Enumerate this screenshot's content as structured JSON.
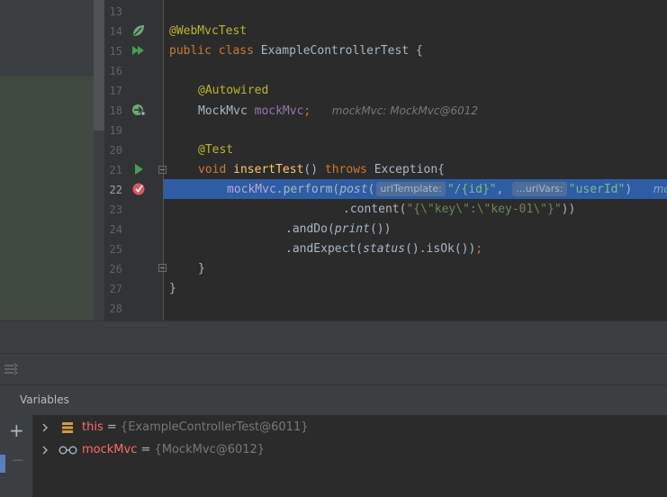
{
  "editor": {
    "lines": [
      {
        "num": "13"
      },
      {
        "num": "14",
        "ann": "@WebMvcTest"
      },
      {
        "num": "15",
        "kw1": "public",
        "kw2": "class",
        "cls": "ExampleControllerTest",
        "brace": "{"
      },
      {
        "num": "16"
      },
      {
        "num": "17",
        "ann": "@Autowired"
      },
      {
        "num": "18",
        "type": "MockMvc",
        "field": "mockMvc",
        "semi": ";",
        "hint": "mockMvc: MockMvc@6012"
      },
      {
        "num": "19"
      },
      {
        "num": "20",
        "ann": "@Test"
      },
      {
        "num": "21",
        "kw": "void",
        "method": "insertTest",
        "params": "()",
        "throws": "throws",
        "exc": "Exception{"
      },
      {
        "num": "22",
        "field": "mockMvc",
        "dot_perform": ".perform(",
        "post": "post",
        "paren": "(",
        "ph1": "urlTemplate:",
        "str1": "\"/{id}\"",
        "comma": ",",
        "ph2": "...uriVars:",
        "str2": "\"userId\"",
        "close": ")",
        "trail": "mc"
      },
      {
        "num": "23",
        "content": ".content(",
        "str": "\"{\\\"key\\\":\\\"key-01\\\"}\"",
        "close": "))"
      },
      {
        "num": "24",
        "andDo": ".andDo(",
        "print": "print",
        "close": "())"
      },
      {
        "num": "25",
        "andExpect": ".andExpect(",
        "status": "status",
        "rest": "().isOk())",
        "semi": ";"
      },
      {
        "num": "26",
        "brace": "}"
      },
      {
        "num": "27",
        "brace": "}"
      },
      {
        "num": "28"
      }
    ],
    "current_line": "22"
  },
  "debug": {
    "toolbar_icon": "settings-toggle-icon",
    "variables_title": "Variables",
    "vars": [
      {
        "name": "this",
        "eq": "=",
        "value": "{ExampleControllerTest@6011}",
        "icon": "field-icon"
      },
      {
        "name": "mockMvc",
        "eq": "=",
        "value": "{MockMvc@6012}",
        "icon": "watch-glasses-icon"
      }
    ],
    "add_label": "+",
    "remove_label": "−"
  },
  "colors": {
    "background": "#2b2b2b",
    "highlight": "#2d5da4",
    "keyword": "#cc7832",
    "annotation": "#bbb529",
    "field": "#9876aa",
    "string": "#6a8759",
    "method": "#ffc66d"
  }
}
